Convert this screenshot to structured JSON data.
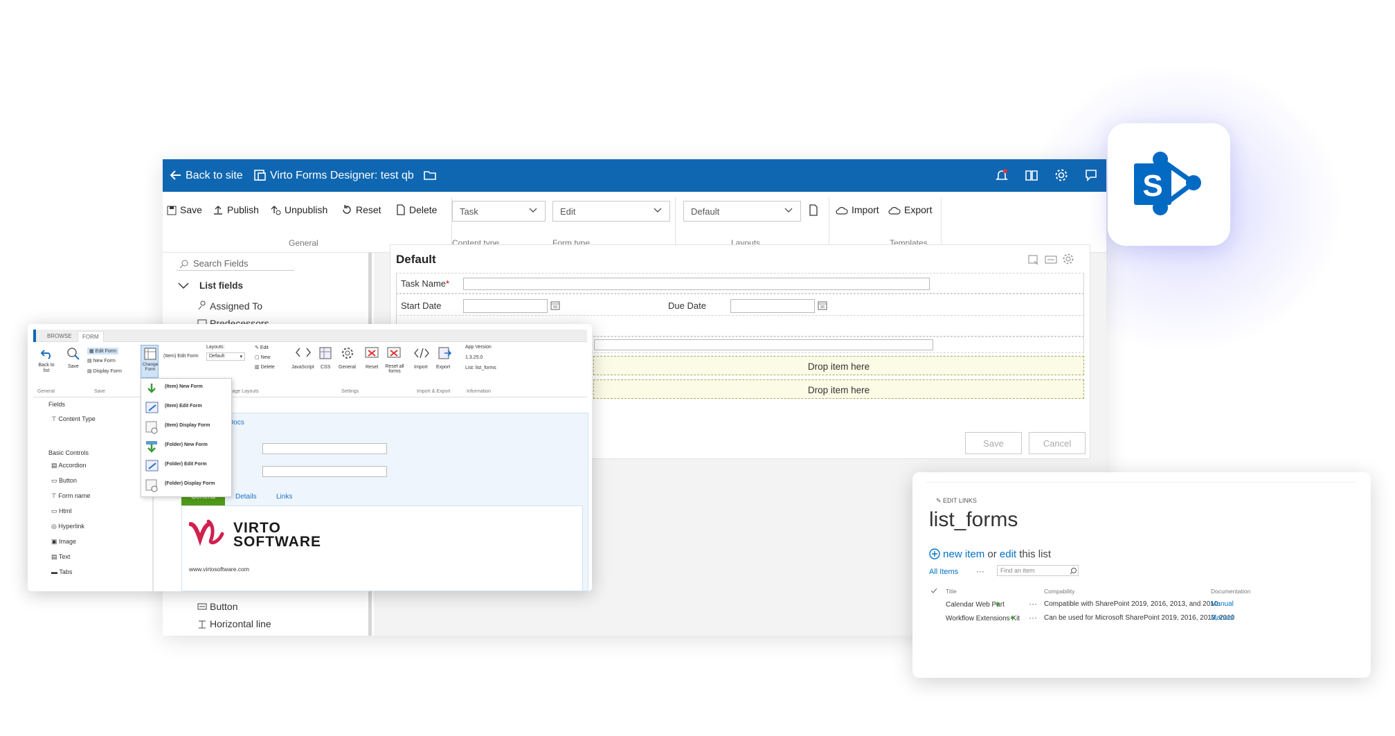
{
  "topbar": {
    "back": "Back to site",
    "title": "Virto Forms Designer: test qb"
  },
  "ribbon": {
    "save": "Save",
    "publish": "Publish",
    "unpublish": "Unpublish",
    "reset": "Reset",
    "delete": "Delete",
    "general_label": "General",
    "content_type_value": "Task",
    "content_type_label": "Content type",
    "form_type_value": "Edit",
    "form_type_label": "Form type",
    "layout_value": "Default",
    "layouts_label": "Layouts",
    "import": "Import",
    "export": "Export",
    "templates_label": "Templates"
  },
  "leftpane": {
    "search_placeholder": "Search Fields",
    "list_fields": "List fields",
    "fields": [
      "Assigned To",
      "Predecessors"
    ],
    "bottom_fields": [
      "Button",
      "Horizontal line"
    ]
  },
  "form": {
    "title": "Default",
    "task_name": "Task Name",
    "required": "*",
    "start_date": "Start Date",
    "due_date": "Due Date",
    "drop1": "Drop item here",
    "drop2": "Drop item here",
    "save": "Save",
    "cancel": "Cancel"
  },
  "old": {
    "tabs": [
      "BROWSE",
      "FORM"
    ],
    "back_to_list": "Back to list",
    "save": "Save",
    "group_general": "General",
    "group_save": "Save",
    "forms": [
      "Edit Form",
      "New Form",
      "Display Form"
    ],
    "change_form": "Change Form",
    "item_edit_form": "(Item) Edit Form",
    "layouts_label": "Layouts:",
    "layout_value": "Default",
    "layout_actions": [
      "Edit",
      "New",
      "Delete"
    ],
    "manage_layouts": "Manage Layouts",
    "settings_buttons": [
      "JavaScript",
      "CSS",
      "General",
      "Reset",
      "Reset all forms"
    ],
    "settings_label": "Settings",
    "ie_buttons": [
      "Import",
      "Export"
    ],
    "ie_label": "Import & Export",
    "app_version_label": "App Version",
    "app_version": "1.3.25.0",
    "list_label": "List: list_forms",
    "info_label": "Information",
    "dropdown": [
      "(Item) New Form",
      "(Item) Edit Form",
      "(Item) Display Form",
      "(Folder) New Form",
      "(Folder) Edit Form",
      "(Folder) Display Form"
    ],
    "fields_title": "Fields",
    "content_type": "Content Type",
    "basic_controls": "Basic Controls",
    "controls": [
      "Accordion",
      "Button",
      "Form name",
      "Html",
      "Hyperlink",
      "Image",
      "Text",
      "Tabs"
    ],
    "docs": "Docs",
    "tabs2": [
      "General",
      "Details",
      "Links"
    ],
    "brand_line1": "VIRTO",
    "brand_line2": "SOFTWARE",
    "url": "www.virtosoftware.com"
  },
  "list": {
    "edit_links": "EDIT LINKS",
    "title": "list_forms",
    "new_item": "new item",
    "or": "or",
    "edit": "edit",
    "this_list": "this list",
    "all_items": "All Items",
    "more": "···",
    "find_placeholder": "Find an item",
    "columns": [
      "Title",
      "Compability",
      "Documentation"
    ],
    "rows": [
      {
        "title": "Calendar Web Part",
        "compat": "Compatible with SharePoint 2019, 2016, 2013, and 2010.",
        "doc": "Manual"
      },
      {
        "title": "Workflow Extensions Kit",
        "compat": "Can be used for Microsoft SharePoint 2019, 2016, 2013, 2010",
        "doc": "Manual"
      }
    ]
  },
  "colors": {
    "brand_blue": "#0f67b1",
    "sharepoint_blue": "#036ac4",
    "virto_red": "#d1214e",
    "link_blue": "#0072c6",
    "green_tab": "#4f9a18"
  }
}
